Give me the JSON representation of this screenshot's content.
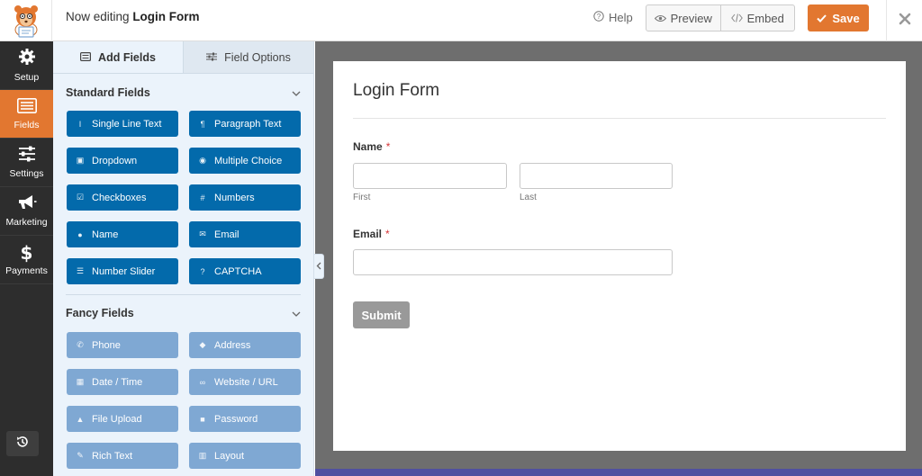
{
  "header": {
    "editing_prefix": "Now editing",
    "form_name": "Login Form",
    "help_label": "Help",
    "preview_label": "Preview",
    "embed_label": "Embed",
    "save_label": "Save"
  },
  "nav": {
    "items": [
      {
        "label": "Setup",
        "icon": "gear-icon"
      },
      {
        "label": "Fields",
        "icon": "list-icon",
        "active": true
      },
      {
        "label": "Settings",
        "icon": "sliders-icon"
      },
      {
        "label": "Marketing",
        "icon": "megaphone-icon"
      },
      {
        "label": "Payments",
        "icon": "dollar-icon"
      }
    ]
  },
  "panel": {
    "tabs": [
      "Add Fields",
      "Field Options"
    ],
    "standard_title": "Standard Fields",
    "standard_fields": [
      {
        "label": "Single Line Text",
        "icon": "text-cursor-icon"
      },
      {
        "label": "Paragraph Text",
        "icon": "paragraph-icon"
      },
      {
        "label": "Dropdown",
        "icon": "dropdown-icon"
      },
      {
        "label": "Multiple Choice",
        "icon": "radio-icon"
      },
      {
        "label": "Checkboxes",
        "icon": "checkbox-icon"
      },
      {
        "label": "Numbers",
        "icon": "hash-icon"
      },
      {
        "label": "Name",
        "icon": "user-icon"
      },
      {
        "label": "Email",
        "icon": "envelope-icon"
      },
      {
        "label": "Number Slider",
        "icon": "slider-icon"
      },
      {
        "label": "CAPTCHA",
        "icon": "question-icon"
      }
    ],
    "fancy_title": "Fancy Fields",
    "fancy_fields": [
      {
        "label": "Phone",
        "icon": "phone-icon"
      },
      {
        "label": "Address",
        "icon": "map-pin-icon"
      },
      {
        "label": "Date / Time",
        "icon": "calendar-icon"
      },
      {
        "label": "Website / URL",
        "icon": "link-icon"
      },
      {
        "label": "File Upload",
        "icon": "upload-icon"
      },
      {
        "label": "Password",
        "icon": "lock-icon"
      },
      {
        "label": "Rich Text",
        "icon": "edit-icon"
      },
      {
        "label": "Layout",
        "icon": "columns-icon"
      }
    ]
  },
  "form": {
    "title": "Login Form",
    "name_label": "Name",
    "name_first_sublabel": "First",
    "name_last_sublabel": "Last",
    "email_label": "Email",
    "required_mark": "*",
    "submit_label": "Submit"
  },
  "colors": {
    "accent": "#e27730",
    "standard_field": "#036aab",
    "fancy_field": "#7fa8d3",
    "nav_bg": "#2d2d2d",
    "panel_bg": "#ebf3fb"
  }
}
